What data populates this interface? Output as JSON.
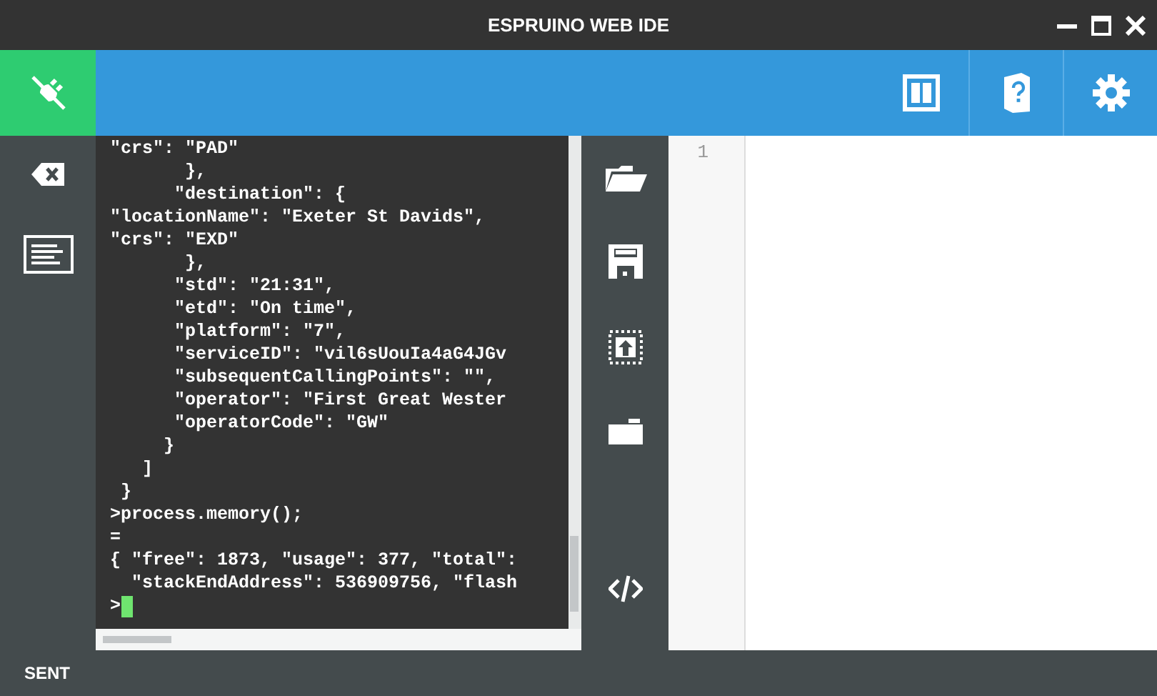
{
  "window": {
    "title": "ESPRUINO WEB IDE"
  },
  "terminal": {
    "lines": [
      "\"crs\": \"PAD\"",
      "       },",
      "      \"destination\": {",
      "\"locationName\": \"Exeter St Davids\",",
      "\"crs\": \"EXD\"",
      "       },",
      "      \"std\": \"21:31\",",
      "      \"etd\": \"On time\",",
      "      \"platform\": \"7\",",
      "      \"serviceID\": \"vil6sUouIa4aG4JGv",
      "      \"subsequentCallingPoints\": \"\",",
      "      \"operator\": \"First Great Wester",
      "      \"operatorCode\": \"GW\"",
      "     }",
      "   ]",
      " }",
      ">process.memory();",
      "=",
      "{ \"free\": 1873, \"usage\": 377, \"total\":",
      "  \"stackEndAddress\": 536909756, \"flash"
    ],
    "prompt": ">"
  },
  "editor": {
    "line_numbers": [
      "1"
    ]
  },
  "status_bar": {
    "text": "SENT"
  }
}
